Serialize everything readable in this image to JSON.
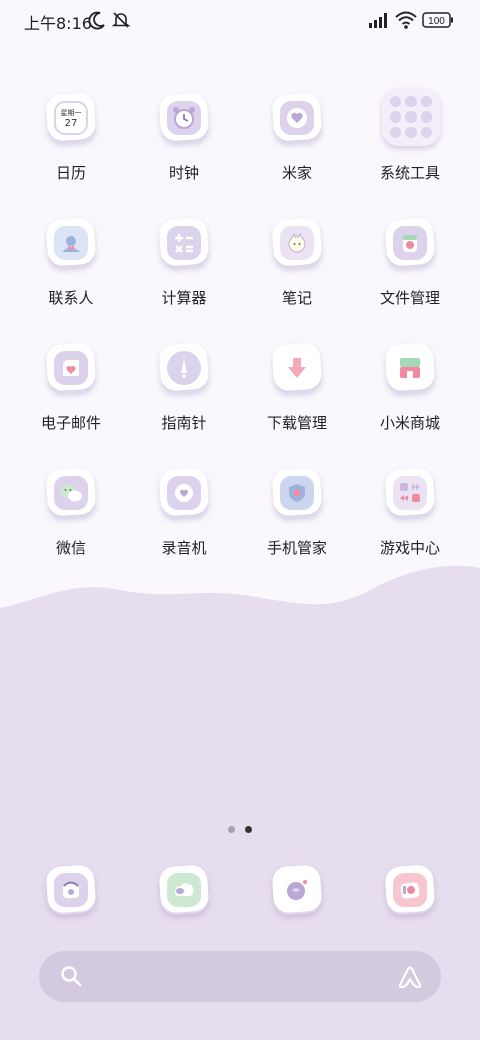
{
  "status_bar": {
    "time": "上午8:16",
    "battery": "100",
    "icons": [
      "moon-icon",
      "notifications-off-icon",
      "signal-icon",
      "wifi-icon",
      "battery-icon"
    ]
  },
  "apps": [
    {
      "label": "日历",
      "icon": "calendar-icon",
      "weekday": "星期一",
      "day": "27"
    },
    {
      "label": "时钟",
      "icon": "alarm-clock-icon"
    },
    {
      "label": "米家",
      "icon": "home-heart-icon"
    },
    {
      "label": "系统工具",
      "icon": "folder-icon"
    },
    {
      "label": "联系人",
      "icon": "contacts-icon"
    },
    {
      "label": "计算器",
      "icon": "calculator-icon"
    },
    {
      "label": "笔记",
      "icon": "notes-icon"
    },
    {
      "label": "文件管理",
      "icon": "file-manager-icon"
    },
    {
      "label": "电子邮件",
      "icon": "email-icon"
    },
    {
      "label": "指南针",
      "icon": "compass-icon"
    },
    {
      "label": "下载管理",
      "icon": "download-icon"
    },
    {
      "label": "小米商城",
      "icon": "store-icon"
    },
    {
      "label": "微信",
      "icon": "wechat-icon"
    },
    {
      "label": "录音机",
      "icon": "recorder-icon"
    },
    {
      "label": "手机管家",
      "icon": "security-shield-icon"
    },
    {
      "label": "游戏中心",
      "icon": "game-center-icon"
    }
  ],
  "dock": [
    {
      "icon": "phone-icon"
    },
    {
      "icon": "messages-icon"
    },
    {
      "icon": "browser-icon"
    },
    {
      "icon": "camera-icon"
    }
  ],
  "page_indicator": {
    "pages": 2,
    "current": 2
  },
  "search_bar": {
    "icons": [
      "search-icon",
      "assistant-icon"
    ]
  },
  "colors": {
    "background": "#faf8fd",
    "wave": "#e6ddef",
    "icon_inner": "#dcd2ec",
    "accent_pink": "#f08aa0",
    "search_bar": "#d4cadf"
  }
}
